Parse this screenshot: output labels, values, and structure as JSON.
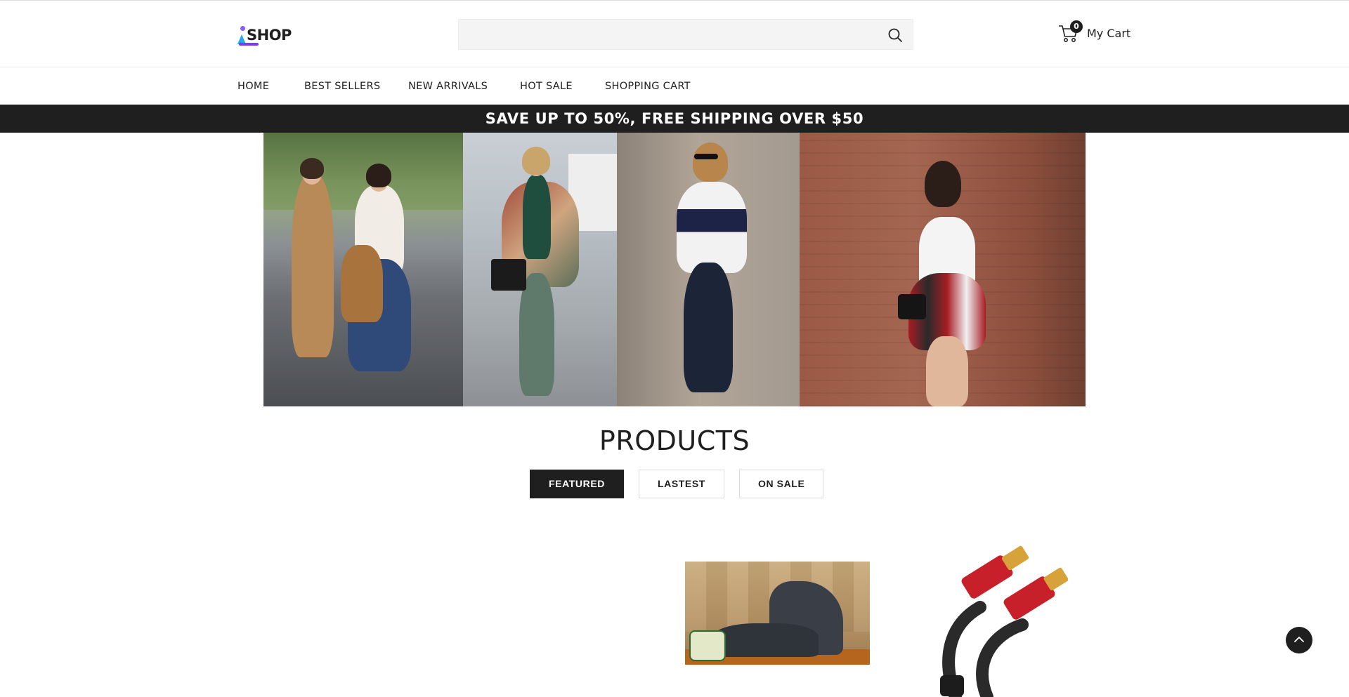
{
  "header": {
    "logo_text": "SHOP",
    "search": {
      "value": "",
      "placeholder": ""
    },
    "cart": {
      "count": "0",
      "label": "My Cart"
    }
  },
  "nav": {
    "items": [
      {
        "label": "HOME"
      },
      {
        "label": "BEST SELLERS"
      },
      {
        "label": "NEW ARRIVALS"
      },
      {
        "label": "HOT SALE"
      },
      {
        "label": "SHOPPING CART"
      }
    ]
  },
  "promo": {
    "text": "SAVE UP TO 50%, FREE SHIPPING OVER $50"
  },
  "products": {
    "title": "PRODUCTS",
    "tabs": [
      {
        "label": "FEATURED"
      },
      {
        "label": "LASTEST"
      },
      {
        "label": "ON SALE"
      }
    ]
  },
  "colors": {
    "dark": "#1f1f1f",
    "search_bg": "#f4f4f4",
    "border": "#dcdcdc"
  },
  "icons": {
    "search": "search-icon",
    "cart": "cart-icon",
    "scroll_top": "chevron-up-icon"
  }
}
